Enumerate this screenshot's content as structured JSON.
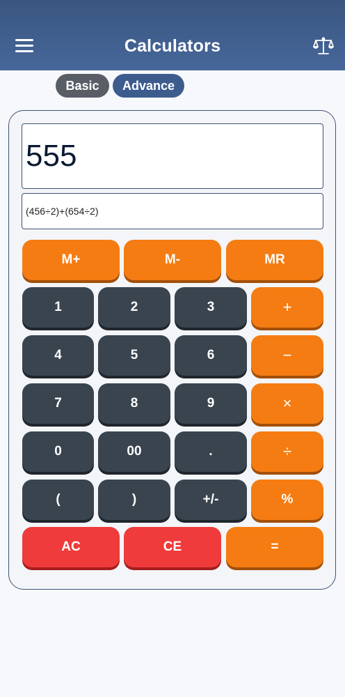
{
  "app": {
    "title": "Calculators"
  },
  "tabs": {
    "basic": "Basic",
    "advance": "Advance"
  },
  "display": {
    "result": "555",
    "expression": "(456÷2)+(654÷2)"
  },
  "memory": {
    "m_plus": "M+",
    "m_minus": "M-",
    "mr": "MR"
  },
  "keys": {
    "k1": "1",
    "k2": "2",
    "k3": "3",
    "plus": "+",
    "k4": "4",
    "k5": "5",
    "k6": "6",
    "minus": "−",
    "k7": "7",
    "k8": "8",
    "k9": "9",
    "times": "×",
    "k0": "0",
    "k00": "00",
    "dot": ".",
    "divide": "÷",
    "lparen": "(",
    "rparen": ")",
    "sign": "+/-",
    "percent": "%",
    "ac": "AC",
    "ce": "CE",
    "equals": "="
  },
  "colors": {
    "appbar": "#3d5c8e",
    "key_dark": "#39444f",
    "key_orange": "#f57c12",
    "key_red": "#ef3b3b"
  }
}
